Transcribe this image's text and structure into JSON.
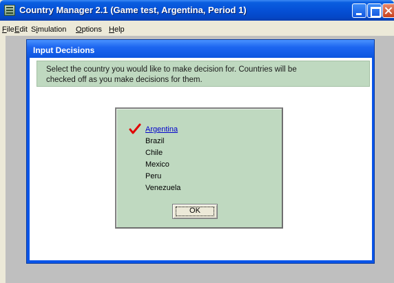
{
  "window": {
    "title": "Country Manager 2.1 (Game test, Argentina, Period 1)"
  },
  "menu": [
    {
      "accel": "F",
      "rest": "ile"
    },
    {
      "accel": "E",
      "rest": "dit"
    },
    {
      "pre": "S",
      "accel": "i",
      "rest": "mulation"
    },
    {
      "accel": "O",
      "rest": "ptions"
    },
    {
      "accel": "H",
      "rest": "elp"
    }
  ],
  "dialog": {
    "title": "Input Decisions",
    "instructions_line1": "Select the country you would like to make decision for.  Countries will be",
    "instructions_line2": "checked off as you make decisions for them.",
    "countries": [
      {
        "name": "Argentina",
        "checked": true
      },
      {
        "name": "Brazil",
        "checked": false
      },
      {
        "name": "Chile",
        "checked": false
      },
      {
        "name": "Mexico",
        "checked": false
      },
      {
        "name": "Peru",
        "checked": false
      },
      {
        "name": "Venezuela",
        "checked": false
      }
    ],
    "ok_label": "OK"
  },
  "colors": {
    "titlebar": "#0550d6",
    "panel_green": "#bfd9c0",
    "checkmark": "#e00000",
    "link": "#0000cc"
  },
  "icons": {
    "app": "app-icon",
    "check": "checkmark-icon"
  }
}
